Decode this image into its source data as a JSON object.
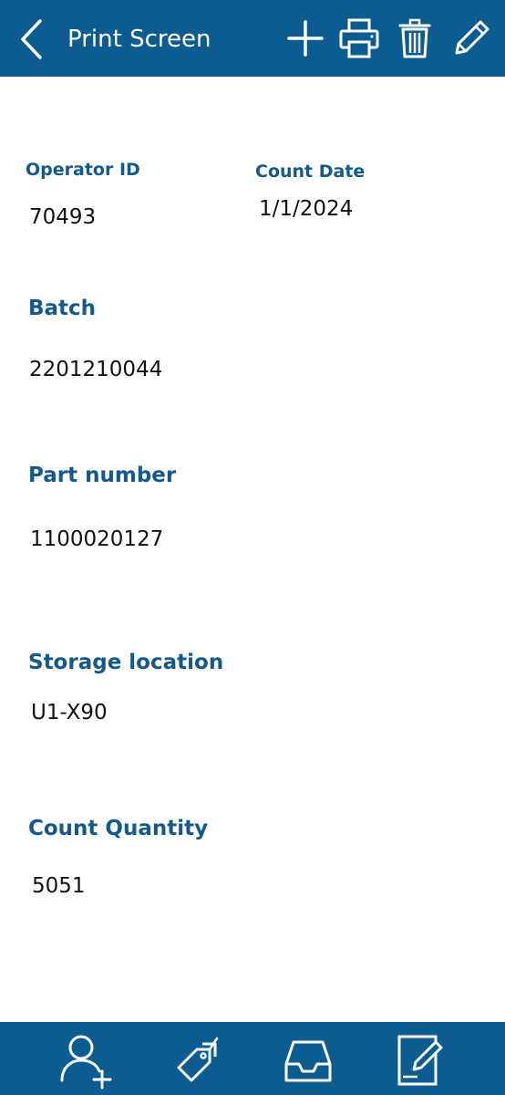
{
  "header": {
    "title": "Print Screen",
    "icons": [
      "back-icon",
      "plus-icon",
      "printer-icon",
      "trash-icon",
      "pencil-icon"
    ],
    "color": "#0d5c91"
  },
  "fields": {
    "operator_id": {
      "label": "Operator ID",
      "value": "70493"
    },
    "count_date": {
      "label": "Count Date",
      "value": "1/1/2024"
    },
    "batch": {
      "label": "Batch",
      "value": "2201210044"
    },
    "part_number": {
      "label": "Part number",
      "value": "1100020127"
    },
    "storage_location": {
      "label": "Storage location",
      "value": "U1-X90"
    },
    "count_quantity": {
      "label": "Count Quantity",
      "value": "5051"
    }
  },
  "footer": {
    "icons": [
      "add-user-icon",
      "tags-icon",
      "inbox-tray-icon",
      "edit-document-icon"
    ]
  },
  "colors": {
    "accent": "#0d5c91",
    "label": "#13598a",
    "text": "#111111",
    "background": "#ffffff"
  }
}
